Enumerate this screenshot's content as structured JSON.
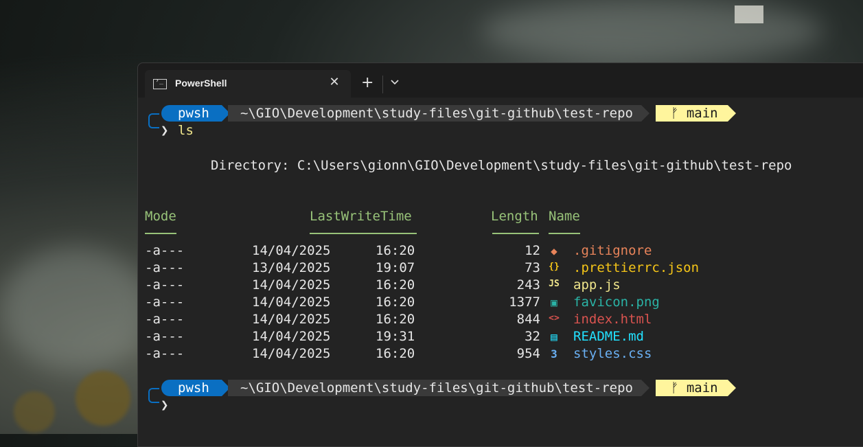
{
  "tab": {
    "title": "PowerShell",
    "close_glyph": "✕",
    "new_glyph": "+"
  },
  "prompt": {
    "shell": "pwsh",
    "path": "~\\GIO\\Development\\study-files\\git-github\\test-repo",
    "branch": "main",
    "branch_glyph": "ᚠ",
    "arrow": "❯",
    "command": "ls"
  },
  "listing": {
    "directory_line": "Directory: C:\\Users\\gionn\\GIO\\Development\\study-files\\git-github\\test-repo",
    "headers": {
      "mode": "Mode",
      "lastwrite": "LastWriteTime",
      "length": "Length",
      "name": "Name"
    },
    "files": [
      {
        "mode": "-a---",
        "date": "14/04/2025",
        "time": "16:20",
        "length": "12",
        "name": ".gitignore",
        "color": "#e8845a",
        "icon": "git-icon",
        "glyph": "◆"
      },
      {
        "mode": "-a---",
        "date": "13/04/2025",
        "time": "19:07",
        "length": "73",
        "name": ".prettierrc.json",
        "color": "#f5c518",
        "icon": "json-icon",
        "glyph": "{}"
      },
      {
        "mode": "-a---",
        "date": "14/04/2025",
        "time": "16:20",
        "length": "243",
        "name": "app.js",
        "color": "#f0e68c",
        "icon": "js-icon",
        "glyph": "JS"
      },
      {
        "mode": "-a---",
        "date": "14/04/2025",
        "time": "16:20",
        "length": "1377",
        "name": "favicon.png",
        "color": "#2ab3a6",
        "icon": "image-icon",
        "glyph": "▣"
      },
      {
        "mode": "-a---",
        "date": "14/04/2025",
        "time": "16:20",
        "length": "844",
        "name": "index.html",
        "color": "#d9534f",
        "icon": "html-icon",
        "glyph": "<>"
      },
      {
        "mode": "-a---",
        "date": "14/04/2025",
        "time": "19:31",
        "length": "32",
        "name": "README.md",
        "color": "#22e1ff",
        "icon": "readme-icon",
        "glyph": "▤"
      },
      {
        "mode": "-a---",
        "date": "14/04/2025",
        "time": "16:20",
        "length": "954",
        "name": "styles.css",
        "color": "#6ab0f3",
        "icon": "css-icon",
        "glyph": "3"
      }
    ]
  }
}
